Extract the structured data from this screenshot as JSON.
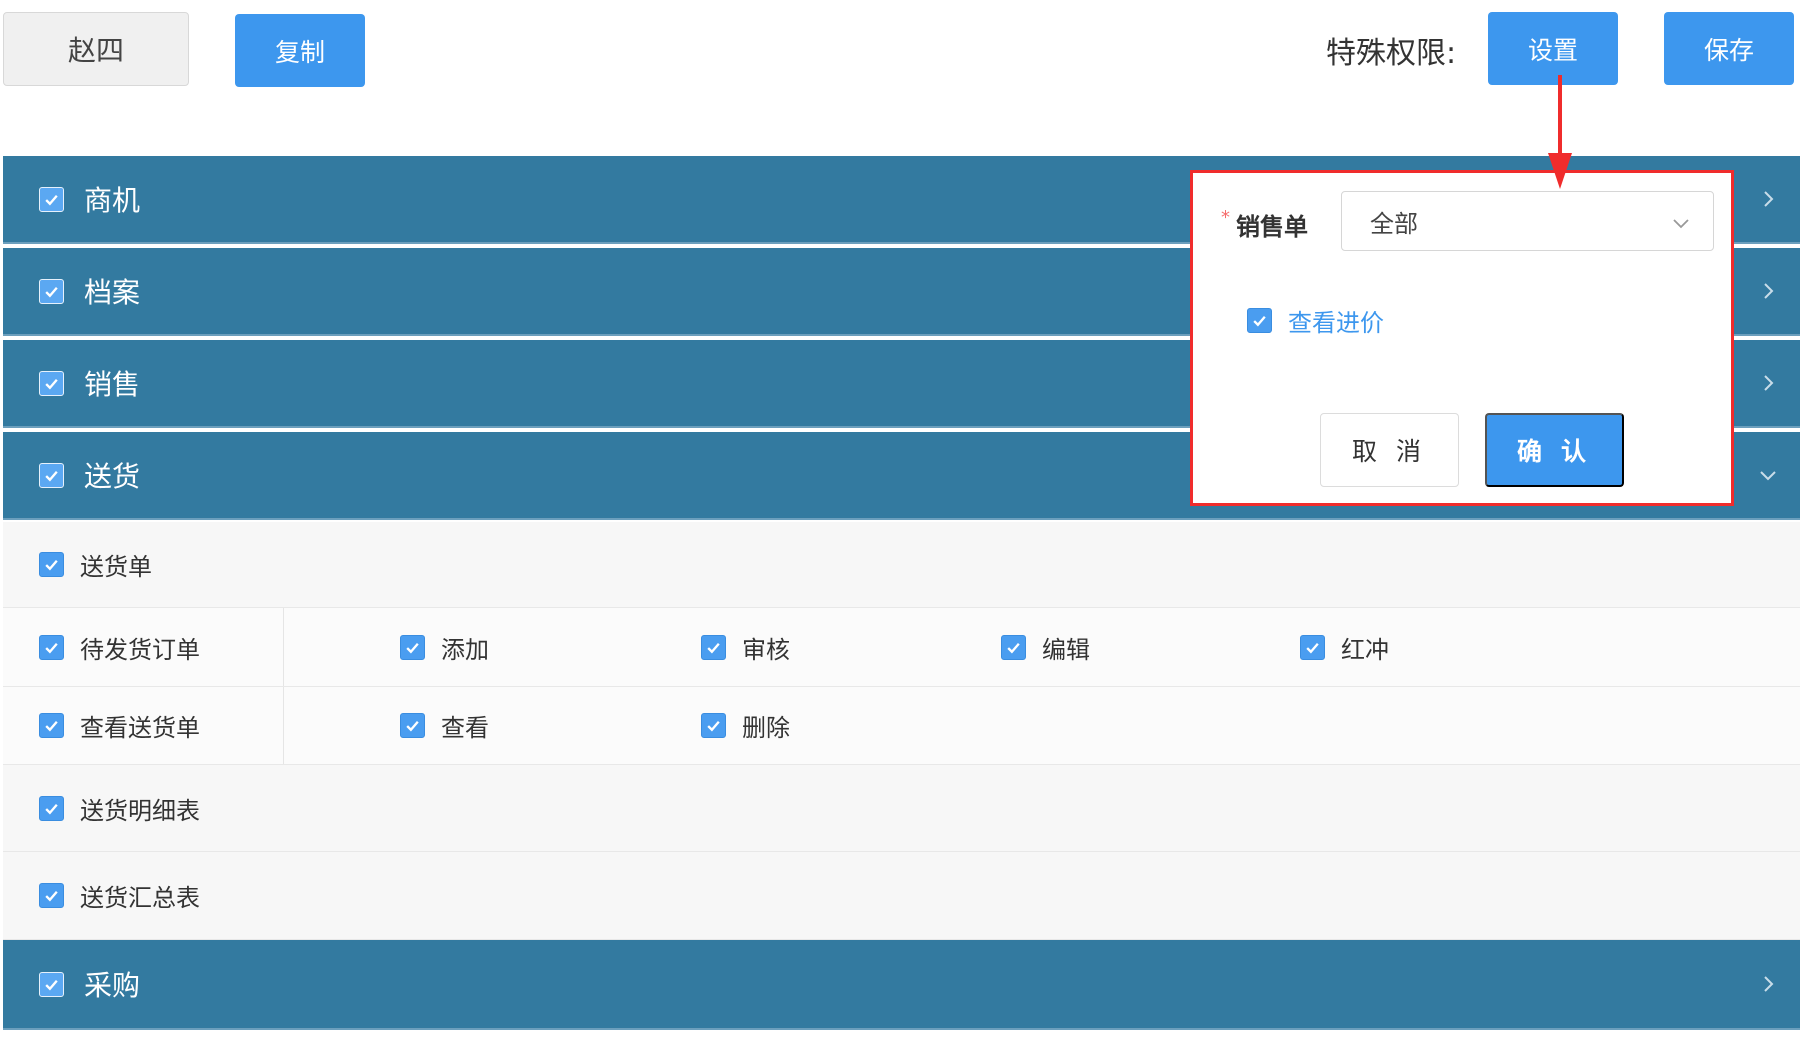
{
  "header": {
    "user_name": "赵四",
    "copy_label": "复制",
    "special_permissions_label": "特殊权限:",
    "settings_label": "设置",
    "save_label": "保存"
  },
  "categories": [
    {
      "label": "商机",
      "checked": true,
      "expanded": false
    },
    {
      "label": "档案",
      "checked": true,
      "expanded": false
    },
    {
      "label": "销售",
      "checked": true,
      "expanded": false
    },
    {
      "label": "送货",
      "checked": true,
      "expanded": true
    },
    {
      "label": "采购",
      "checked": true,
      "expanded": false
    }
  ],
  "delivery": {
    "order_label": "送货单",
    "pending_orders": {
      "label": "待发货订单",
      "permissions": [
        "添加",
        "审核",
        "编辑",
        "红冲"
      ]
    },
    "view_orders": {
      "label": "查看送货单",
      "permissions": [
        "查看",
        "删除"
      ]
    },
    "detail_report_label": "送货明细表",
    "summary_report_label": "送货汇总表"
  },
  "popover": {
    "field_label": "销售单",
    "required_marker": "*",
    "select_value": "全部",
    "check_label": "查看进价",
    "cancel_label": "取 消",
    "confirm_label": "确 认"
  },
  "colors": {
    "category_bar": "#337aa0",
    "primary_button": "#3d97ee",
    "highlight_border": "#f02c2c"
  }
}
